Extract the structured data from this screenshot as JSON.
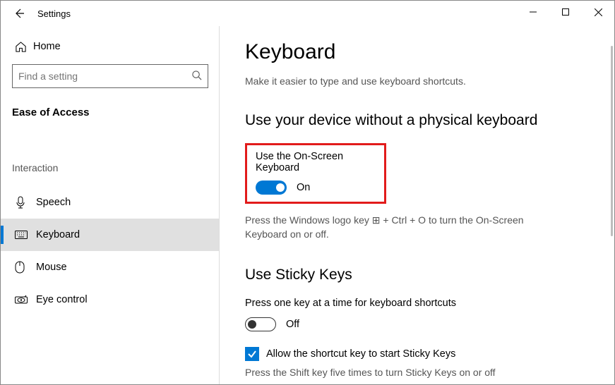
{
  "window": {
    "title": "Settings"
  },
  "sidebar": {
    "home": "Home",
    "search_placeholder": "Find a setting",
    "category": "Ease of Access",
    "section": "Interaction",
    "items": [
      {
        "label": "Speech"
      },
      {
        "label": "Keyboard"
      },
      {
        "label": "Mouse"
      },
      {
        "label": "Eye control"
      }
    ]
  },
  "content": {
    "title": "Keyboard",
    "subtitle": "Make it easier to type and use keyboard shortcuts.",
    "section1_heading": "Use your device without a physical keyboard",
    "osk_label": "Use the On-Screen Keyboard",
    "osk_state": "On",
    "osk_hint_pre": "Press the Windows logo key ",
    "osk_hint_post": " + Ctrl + O to turn the On-Screen Keyboard on or off.",
    "section2_heading": "Use Sticky Keys",
    "sticky_desc": "Press one key at a time for keyboard shortcuts",
    "sticky_state": "Off",
    "sticky_cb_label": "Allow the shortcut key to start Sticky Keys",
    "sticky_hint": "Press the Shift key five times to turn Sticky Keys on or off"
  }
}
